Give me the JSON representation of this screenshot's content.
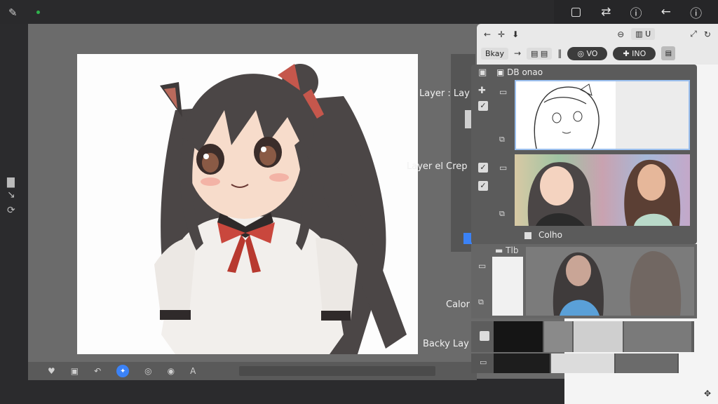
{
  "labels": {
    "layer1": "Layer : Lay",
    "layer2": "Layer el Crep",
    "color": "Calor",
    "backy": "Backy Lay"
  },
  "layers_panel": {
    "header": "DB onao",
    "sub_title": "Colho",
    "group_title": "Tlb"
  },
  "toolbar": {
    "chip1": "U",
    "pill1": "VO",
    "pill2": "INO",
    "btn_label": "Bkay"
  },
  "colors": {
    "workspace": "#6b6b6b",
    "accent": "#3b82f6",
    "panel": "#5b5b5b"
  }
}
